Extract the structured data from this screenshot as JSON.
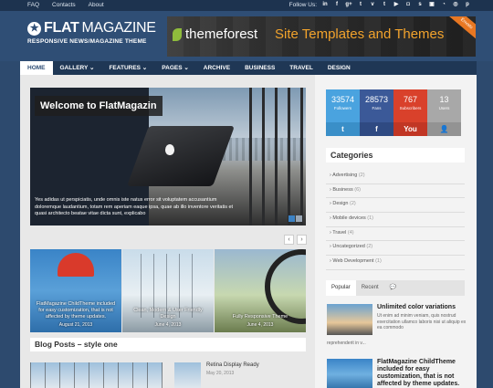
{
  "topbar": {
    "links": [
      "FAQ",
      "Contacts",
      "About"
    ],
    "follow_label": "Follow Us:",
    "social_icons": [
      "linkedin-icon",
      "facebook-icon",
      "googleplus-icon",
      "twitter-icon",
      "vimeo-icon",
      "tumblr-icon",
      "youtube-icon",
      "instagram-icon",
      "stumbleupon-icon",
      "delicious-icon",
      "rss-icon",
      "dribbble-icon",
      "pinterest-icon"
    ]
  },
  "header": {
    "logo_bold": "FLAT",
    "logo_thin": "MAGAZINE",
    "tagline": "RESPONSIVE NEWS/MAGAZINE THEME",
    "banner_brand": "themeforest",
    "banner_slogan": "Site Templates and Themes",
    "banner_corner": "Envato"
  },
  "nav": {
    "items": [
      {
        "label": "HOME",
        "active": true
      },
      {
        "label": "GALLERY ⌄",
        "active": false
      },
      {
        "label": "FEATURES ⌄",
        "active": false
      },
      {
        "label": "PAGES ⌄",
        "active": false
      },
      {
        "label": "ARCHIVE",
        "active": false
      },
      {
        "label": "BUSINESS",
        "active": false
      },
      {
        "label": "TRAVEL",
        "active": false
      },
      {
        "label": "DESIGN",
        "active": false
      }
    ]
  },
  "slider": {
    "title": "Welcome to FlatMagazin",
    "caption": "Yes adidas ut perspiciatis, unde omnis iste natus error sit voluptatem accusantium doloremque laudantium, totam rem aperiam eaque ipsa, quae ab illo inventore veritatis et quasi architecto beatae vitae dicta sunt, explicabo",
    "prev": "‹",
    "next": "›"
  },
  "cards": [
    {
      "caption": "FlatMagazine ChildTheme included for easy customization, that is not affected by theme updates.",
      "date": "August 21, 2013"
    },
    {
      "caption": "Clean, Modern & User Friendly Design",
      "date": "June 4, 2013"
    },
    {
      "caption": "Fully Responsive Theme",
      "date": "June 4, 2013"
    }
  ],
  "blog": {
    "section_title": "Blog Posts – style one",
    "side_post_title": "Retina Display Ready",
    "side_post_date": "May 20, 2013"
  },
  "stats": [
    {
      "num": "33574",
      "label": "Followers",
      "color": "#4aa3df",
      "icon": "t"
    },
    {
      "num": "28573",
      "label": "Fans",
      "color": "#3b5998",
      "icon": "f"
    },
    {
      "num": "767",
      "label": "Subscribers",
      "color": "#d9412b",
      "icon": "You"
    },
    {
      "num": "13",
      "label": "Users",
      "color": "#a8a8a8",
      "icon": "👤"
    }
  ],
  "categories": {
    "title": "Categories",
    "items": [
      {
        "name": "Advertising",
        "count": "(2)"
      },
      {
        "name": "Business",
        "count": "(6)"
      },
      {
        "name": "Design",
        "count": "(2)"
      },
      {
        "name": "Mobile devices",
        "count": "(1)"
      },
      {
        "name": "Travel",
        "count": "(4)"
      },
      {
        "name": "Uncategorized",
        "count": "(2)"
      },
      {
        "name": "Web Development",
        "count": "(1)"
      }
    ]
  },
  "tabs": {
    "popular": "Popular",
    "recent": "Recent",
    "comments_icon": "speech-bubble-icon",
    "posts": [
      {
        "title": "Unlimited color variations",
        "text": "Ut enim ad minim veniam, quis nostrud exercitation ullamco laboris nisi ut aliquip ex ea commodo",
        "more": "reprehenderit in v..."
      },
      {
        "title": "FlatMagazine ChildTheme included for easy customization, that is not affected by theme updates.",
        "text": "",
        "more": ""
      }
    ]
  }
}
